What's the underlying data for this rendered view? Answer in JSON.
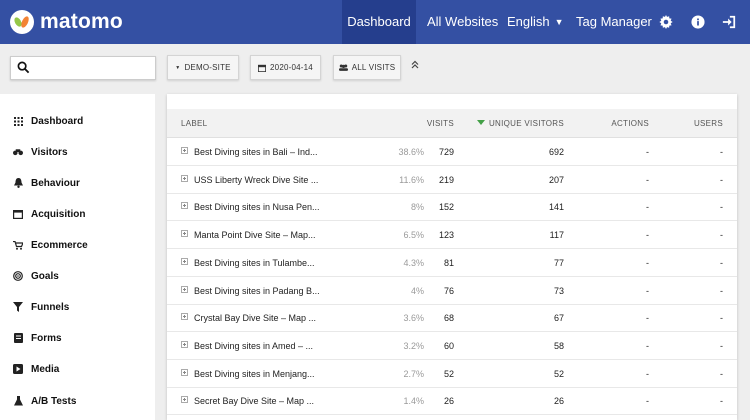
{
  "app": {
    "name": "matomo"
  },
  "nav": {
    "items": [
      {
        "label": "Dashboard",
        "active": true
      },
      {
        "label": "All Websites"
      },
      {
        "label": "English"
      },
      {
        "label": "Tag Manager"
      }
    ],
    "icons": [
      "gear-icon",
      "info-icon",
      "sign-out-icon"
    ]
  },
  "filters": {
    "search_placeholder": "",
    "site": "DEMO-SITE",
    "date": "2020-04-14",
    "segment": "ALL VISITS"
  },
  "sidebar": {
    "items": [
      {
        "label": "Dashboard",
        "icon": "grid-icon"
      },
      {
        "label": "Visitors",
        "icon": "binoculars-icon"
      },
      {
        "label": "Behaviour",
        "icon": "bell-icon"
      },
      {
        "label": "Acquisition",
        "icon": "window-icon"
      },
      {
        "label": "Ecommerce",
        "icon": "cart-icon"
      },
      {
        "label": "Goals",
        "icon": "target-icon"
      },
      {
        "label": "Funnels",
        "icon": "funnel-icon"
      },
      {
        "label": "Forms",
        "icon": "form-icon"
      },
      {
        "label": "Media",
        "icon": "media-icon"
      },
      {
        "label": "A/B Tests",
        "icon": "flask-icon"
      }
    ]
  },
  "table": {
    "columns": {
      "label": "LABEL",
      "visits": "VISITS",
      "unique_visitors": "UNIQUE VISITORS",
      "actions": "ACTIONS",
      "users": "USERS"
    },
    "rows": [
      {
        "label": "Best Diving sites in Bali – Ind...",
        "pct": "38.6%",
        "visits": "729",
        "uv": "692",
        "actions": "-",
        "users": "-"
      },
      {
        "label": "USS Liberty Wreck Dive Site ...",
        "pct": "11.6%",
        "visits": "219",
        "uv": "207",
        "actions": "-",
        "users": "-"
      },
      {
        "label": "Best Diving sites in Nusa Pen...",
        "pct": "8%",
        "visits": "152",
        "uv": "141",
        "actions": "-",
        "users": "-"
      },
      {
        "label": "Manta Point Dive Site – Map...",
        "pct": "6.5%",
        "visits": "123",
        "uv": "117",
        "actions": "-",
        "users": "-"
      },
      {
        "label": "Best Diving sites in Tulambe...",
        "pct": "4.3%",
        "visits": "81",
        "uv": "77",
        "actions": "-",
        "users": "-"
      },
      {
        "label": "Best Diving sites in Padang B...",
        "pct": "4%",
        "visits": "76",
        "uv": "73",
        "actions": "-",
        "users": "-"
      },
      {
        "label": "Crystal Bay Dive Site – Map ...",
        "pct": "3.6%",
        "visits": "68",
        "uv": "67",
        "actions": "-",
        "users": "-"
      },
      {
        "label": "Best Diving sites in Amed – ...",
        "pct": "3.2%",
        "visits": "60",
        "uv": "58",
        "actions": "-",
        "users": "-"
      },
      {
        "label": "Best Diving sites in Menjang...",
        "pct": "2.7%",
        "visits": "52",
        "uv": "52",
        "actions": "-",
        "users": "-"
      },
      {
        "label": "Secret Bay Dive Site – Map ...",
        "pct": "1.4%",
        "visits": "26",
        "uv": "26",
        "actions": "-",
        "users": "-"
      }
    ]
  },
  "colors": {
    "nav_bg": "#3450a3",
    "nav_active": "#253e8d",
    "sort_indicator": "#43a047"
  }
}
